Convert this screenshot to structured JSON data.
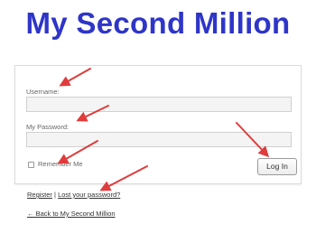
{
  "site": {
    "title": "My Second Million",
    "title_color": "#2e35c8"
  },
  "login_form": {
    "username_label": "Username:",
    "username_value": "",
    "password_label": "My Password:",
    "password_value": "",
    "remember_label": "Remember Me",
    "remember_checked": false,
    "submit_label": "Log In"
  },
  "links": {
    "register": "Register",
    "separator": "|",
    "lost_password": "Lost your password?",
    "back": "← Back to My Second Million"
  },
  "annotations": {
    "arrow_color": "#e03c3c",
    "arrow_count": 5
  }
}
